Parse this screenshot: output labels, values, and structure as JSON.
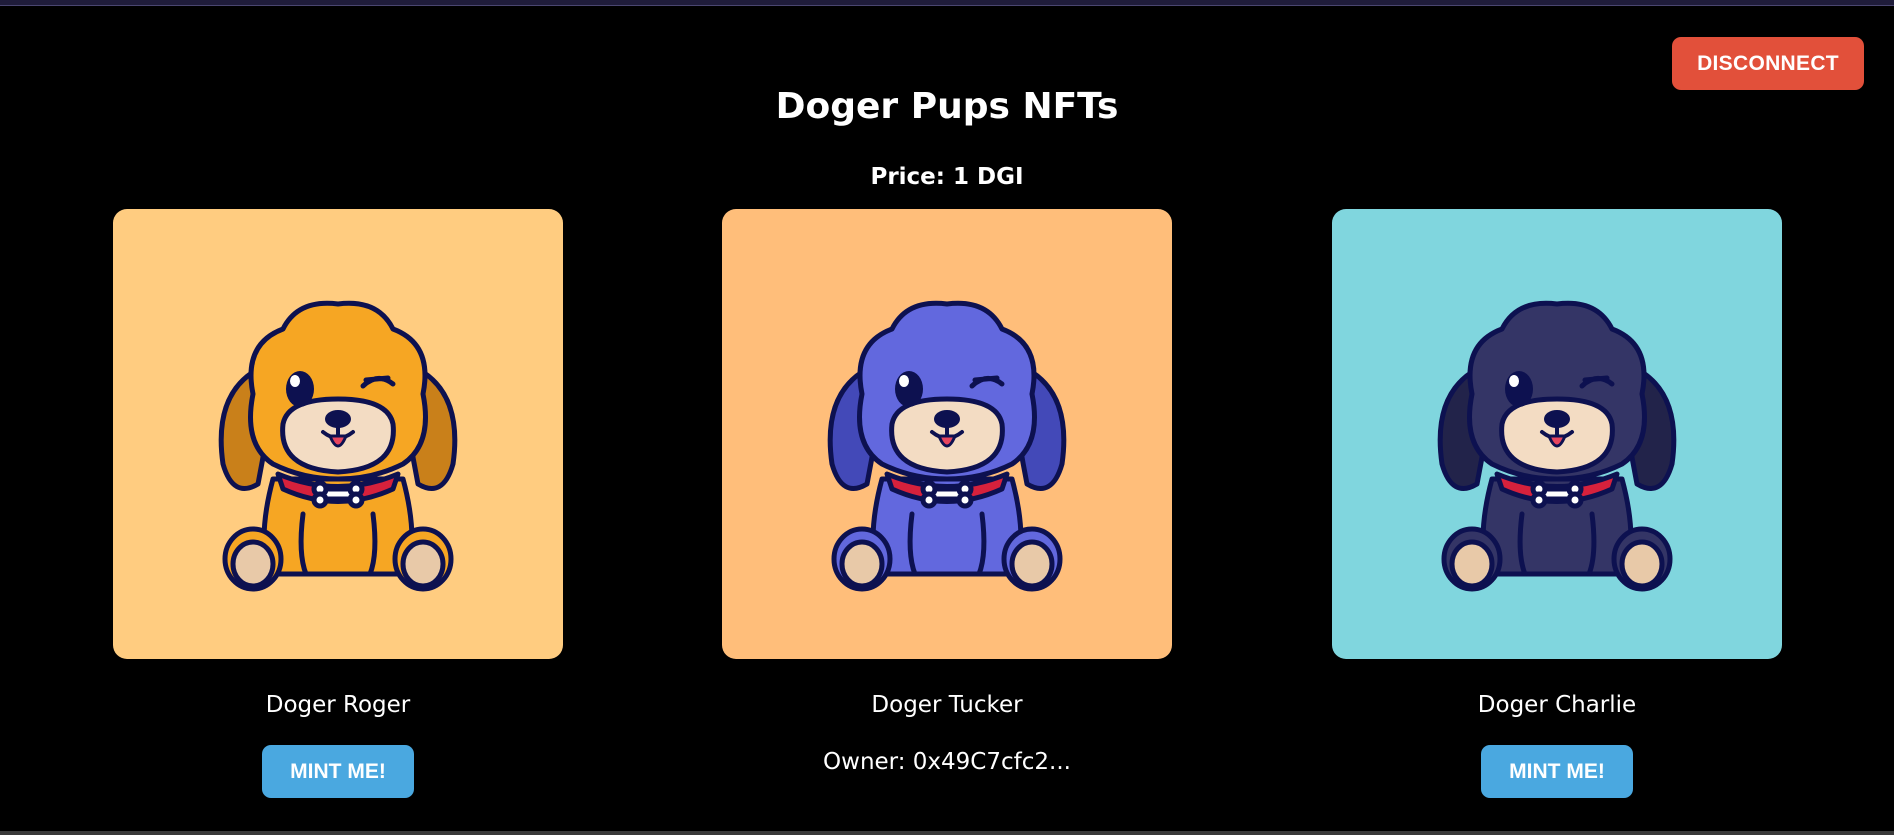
{
  "header": {
    "disconnect_label": "DISCONNECT",
    "title": "Doger Pups NFTs",
    "price": "Price: 1 DGI"
  },
  "colors": {
    "disconnect_bg": "#e2503a",
    "mint_bg": "#4aa8e0",
    "page_bg": "#000000"
  },
  "nfts": [
    {
      "name": "Doger Roger",
      "bg": "#ffcc80",
      "fur": "#f6a623",
      "fur_dark": "#c9801a",
      "icon": "puppy-illustration",
      "action_label": "MINT ME!"
    },
    {
      "name": "Doger Tucker",
      "bg": "#ffbe7a",
      "fur": "#6268de",
      "fur_dark": "#4349b8",
      "icon": "puppy-illustration",
      "owner": "Owner: 0x49C7cfc2..."
    },
    {
      "name": "Doger Charlie",
      "bg": "#80d6de",
      "fur": "#343566",
      "fur_dark": "#22234a",
      "icon": "puppy-illustration",
      "action_label": "MINT ME!"
    }
  ]
}
